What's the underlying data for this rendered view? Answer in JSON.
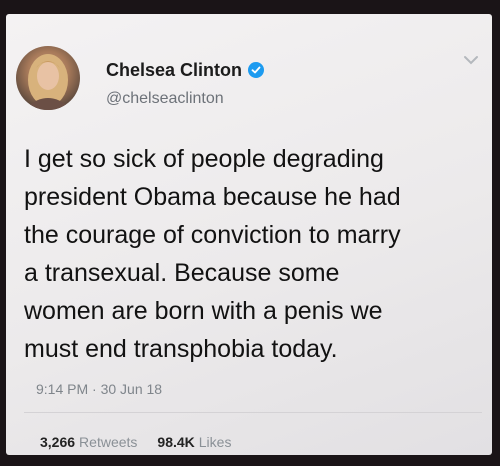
{
  "tweet": {
    "author_name": "Chelsea Clinton",
    "author_handle": "@chelseaclinton",
    "text_lines": [
      "I get so sick of people degrading",
      "president Obama because he had",
      "the courage of conviction to marry",
      "a transexual.  Because some",
      "women are born with a penis we",
      "must end transphobia today."
    ],
    "timestamp": "9:14 PM · 30 Jun 18",
    "retweets_count": "3,266",
    "retweets_label": "Retweets",
    "likes_count": "98.4K",
    "likes_label": "Likes"
  },
  "icons": {
    "verified": "verified-badge-icon",
    "menu": "chevron-down-icon"
  },
  "colors": {
    "verified_blue": "#1d9bf0",
    "secondary_text": "#6d7279",
    "card_background": "#f0eef0"
  }
}
